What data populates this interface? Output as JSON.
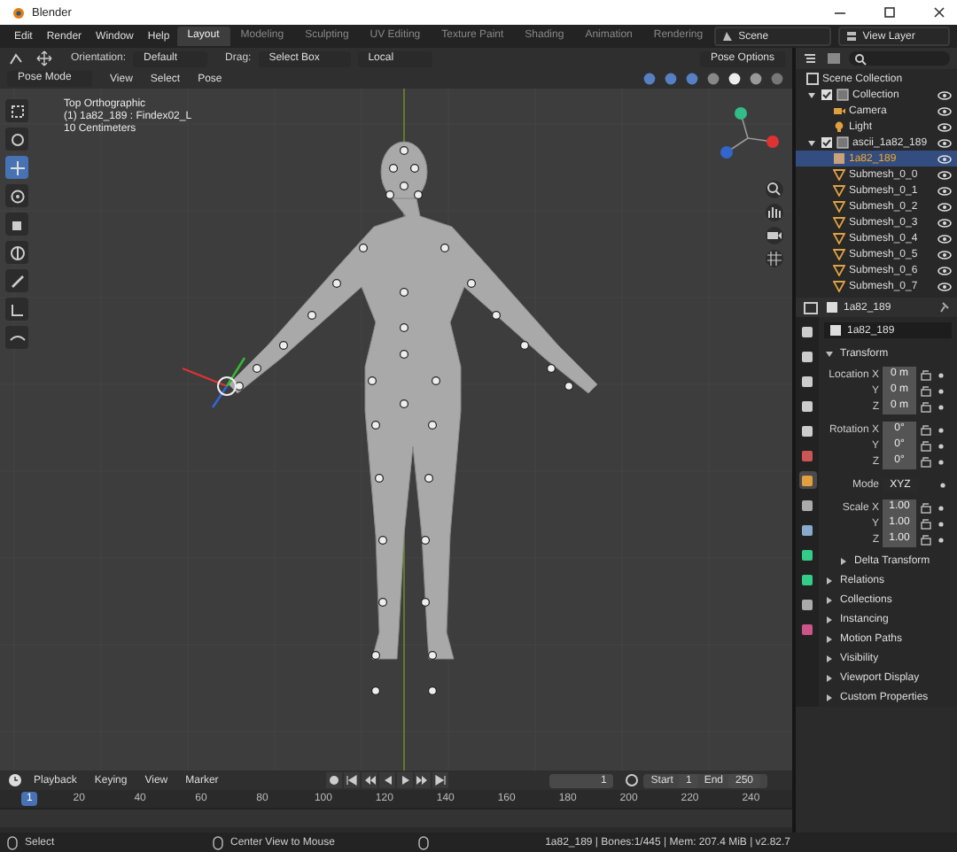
{
  "window": {
    "title": "Blender"
  },
  "menu": [
    "Edit",
    "Render",
    "Window",
    "Help"
  ],
  "workspaces": [
    {
      "label": "Layout",
      "selected": true
    },
    {
      "label": "Modeling",
      "selected": false
    },
    {
      "label": "Sculpting",
      "selected": false
    },
    {
      "label": "UV Editing",
      "selected": false
    },
    {
      "label": "Texture Paint",
      "selected": false
    },
    {
      "label": "Shading",
      "selected": false
    },
    {
      "label": "Animation",
      "selected": false
    },
    {
      "label": "Rendering",
      "selected": false
    }
  ],
  "scene": "Scene",
  "view_layer": "View Layer",
  "tool_header": {
    "orientation_label": "Orientation:",
    "orientation": "Default",
    "drag_label": "Drag:",
    "drag": "Select Box",
    "pivot": "Local",
    "options": "Pose Options"
  },
  "viewport_header": {
    "mode": "Pose Mode",
    "menus": [
      "View",
      "Select",
      "Pose"
    ]
  },
  "viewport": {
    "overlay": [
      "Top Orthographic",
      "(1) 1a82_189 : Findex02_L",
      "10 Centimeters"
    ]
  },
  "tools": [
    {
      "selected": false
    },
    {
      "selected": false
    },
    {
      "selected": true
    },
    {
      "selected": false
    },
    {
      "selected": false
    },
    {
      "selected": false
    },
    {
      "selected": false
    },
    {
      "selected": false
    },
    {
      "selected": false
    }
  ],
  "outliner": {
    "root": "Scene Collection",
    "items": [
      {
        "name": "Collection",
        "kind": "collection",
        "selected": false,
        "expanded": true,
        "children": [
          {
            "name": "Camera",
            "kind": "camera",
            "selected": false
          },
          {
            "name": "Light",
            "kind": "light",
            "selected": false
          }
        ]
      },
      {
        "name": "ascii_1a82_189",
        "kind": "collection",
        "selected": false,
        "expanded": true,
        "children": [
          {
            "name": "1a82_189",
            "kind": "armature",
            "selected": true
          },
          {
            "name": "Submesh_0_0",
            "kind": "mesh",
            "selected": false
          },
          {
            "name": "Submesh_0_1",
            "kind": "mesh",
            "selected": false
          },
          {
            "name": "Submesh_0_2",
            "kind": "mesh",
            "selected": false
          },
          {
            "name": "Submesh_0_3",
            "kind": "mesh",
            "selected": false
          },
          {
            "name": "Submesh_0_4",
            "kind": "mesh",
            "selected": false
          },
          {
            "name": "Submesh_0_5",
            "kind": "mesh",
            "selected": false
          },
          {
            "name": "Submesh_0_6",
            "kind": "mesh",
            "selected": false
          },
          {
            "name": "Submesh_0_7",
            "kind": "mesh",
            "selected": false
          }
        ]
      }
    ]
  },
  "properties": {
    "header_object": "1a82_189",
    "object_name": "1a82_189",
    "tabs": [
      {
        "selected": false
      },
      {
        "selected": false
      },
      {
        "selected": false
      },
      {
        "selected": false
      },
      {
        "selected": false
      },
      {
        "selected": false
      },
      {
        "selected": true
      },
      {
        "selected": false
      },
      {
        "selected": false
      },
      {
        "selected": false
      },
      {
        "selected": false
      },
      {
        "selected": false
      },
      {
        "selected": false
      }
    ],
    "transform": {
      "title": "Transform",
      "expanded": true,
      "rows": [
        {
          "label": "Location X",
          "value": "0 m",
          "kind": "number"
        },
        {
          "label": "Y",
          "value": "0 m",
          "kind": "number"
        },
        {
          "label": "Z",
          "value": "0 m",
          "kind": "number"
        },
        {
          "label": "Rotation X",
          "value": "0°",
          "kind": "number"
        },
        {
          "label": "Y",
          "value": "0°",
          "kind": "number"
        },
        {
          "label": "Z",
          "value": "0°",
          "kind": "number"
        },
        {
          "label": "Mode",
          "value": "XYZ",
          "kind": "dropdown"
        },
        {
          "label": "Scale X",
          "value": "1.00",
          "kind": "number"
        },
        {
          "label": "Y",
          "value": "1.00",
          "kind": "number"
        },
        {
          "label": "Z",
          "value": "1.00",
          "kind": "number"
        }
      ],
      "subpanels": [
        {
          "title": "Delta Transform",
          "expanded": false
        }
      ]
    },
    "panels": [
      {
        "title": "Relations",
        "expanded": false
      },
      {
        "title": "Collections",
        "expanded": false
      },
      {
        "title": "Instancing",
        "expanded": false
      },
      {
        "title": "Motion Paths",
        "expanded": false
      },
      {
        "title": "Visibility",
        "expanded": false
      },
      {
        "title": "Viewport Display",
        "expanded": false
      },
      {
        "title": "Custom Properties",
        "expanded": false
      }
    ]
  },
  "timeline": {
    "menus": [
      "Playback",
      "Keying",
      "View",
      "Marker"
    ],
    "current_frame": "1",
    "ruler_frame": "1",
    "start_label": "Start",
    "start": "1",
    "end_label": "End",
    "end": "250",
    "ruler": [
      "20",
      "40",
      "60",
      "80",
      "100",
      "120",
      "140",
      "160",
      "180",
      "200",
      "220",
      "240"
    ]
  },
  "status_bar": {
    "hints": [
      "Select",
      "Center View to Mouse"
    ],
    "info": "1a82_189 | Bones:1/445 | Mem: 207.4 MiB | v2.82.7"
  }
}
